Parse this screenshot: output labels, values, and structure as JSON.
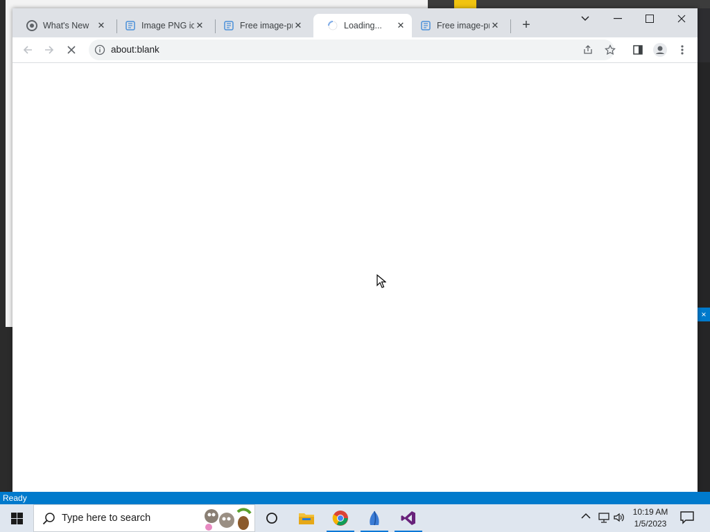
{
  "browser": {
    "tabs": [
      {
        "label": "What's New",
        "icon": "chrome-icon",
        "active": false
      },
      {
        "label": "Image PNG ico",
        "icon": "page-favicon-icon",
        "active": false
      },
      {
        "label": "Free image-pn",
        "icon": "page-favicon-icon",
        "active": false
      },
      {
        "label": "Loading...",
        "icon": "loading-spinner-icon",
        "active": true
      },
      {
        "label": "Free image-pn",
        "icon": "page-favicon-icon",
        "active": false
      }
    ],
    "address": "about:blank"
  },
  "statusbar": {
    "text": "Ready"
  },
  "taskbar": {
    "search_placeholder": "Type here to search",
    "time": "10:19 AM",
    "date": "1/5/2023"
  },
  "colors": {
    "accent": "#007acc",
    "tabstrip": "#dee1e6",
    "taskbar": "#dfe6ef"
  }
}
